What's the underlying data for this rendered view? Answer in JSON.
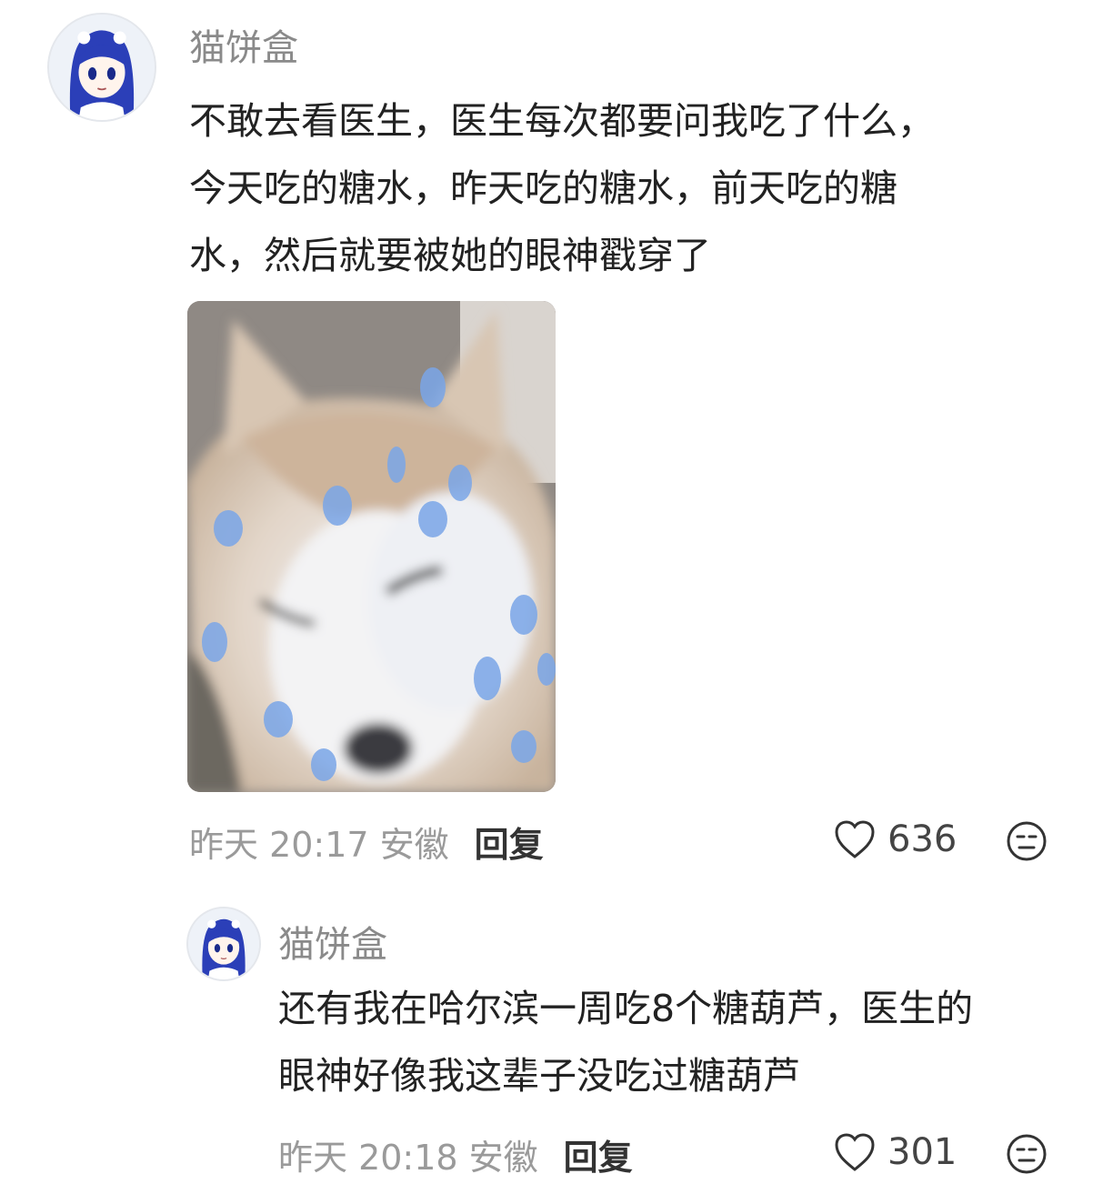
{
  "comments": [
    {
      "username": "猫饼盒",
      "lines": [
        "不敢去看医生，医生每次都要问我吃了什么，",
        "今天吃的糖水，昨天吃的糖水，前天吃的糖",
        "水，然后就要被她的眼神戳穿了"
      ],
      "has_image": true,
      "meta": "昨天 20:17 安徽",
      "reply_label": "回复",
      "likes": "636",
      "icons": {
        "avatar": "anime-girl-avatar",
        "like": "heart-outline-icon",
        "react": "meh-face-icon"
      }
    },
    {
      "username": "猫饼盒",
      "lines": [
        "还有我在哈尔滨一周吃8个糖葫芦，医生的",
        "眼神好像我这辈子没吃过糖葫芦"
      ],
      "meta": "昨天 20:18 安徽",
      "reply_label": "回复",
      "likes": "301",
      "icons": {
        "avatar": "anime-girl-avatar",
        "like": "heart-outline-icon",
        "react": "meh-face-icon"
      }
    }
  ],
  "colors": {
    "username": "#8a8a8a",
    "text": "#222222",
    "meta": "#9a9a9a",
    "reply": "#333333"
  }
}
